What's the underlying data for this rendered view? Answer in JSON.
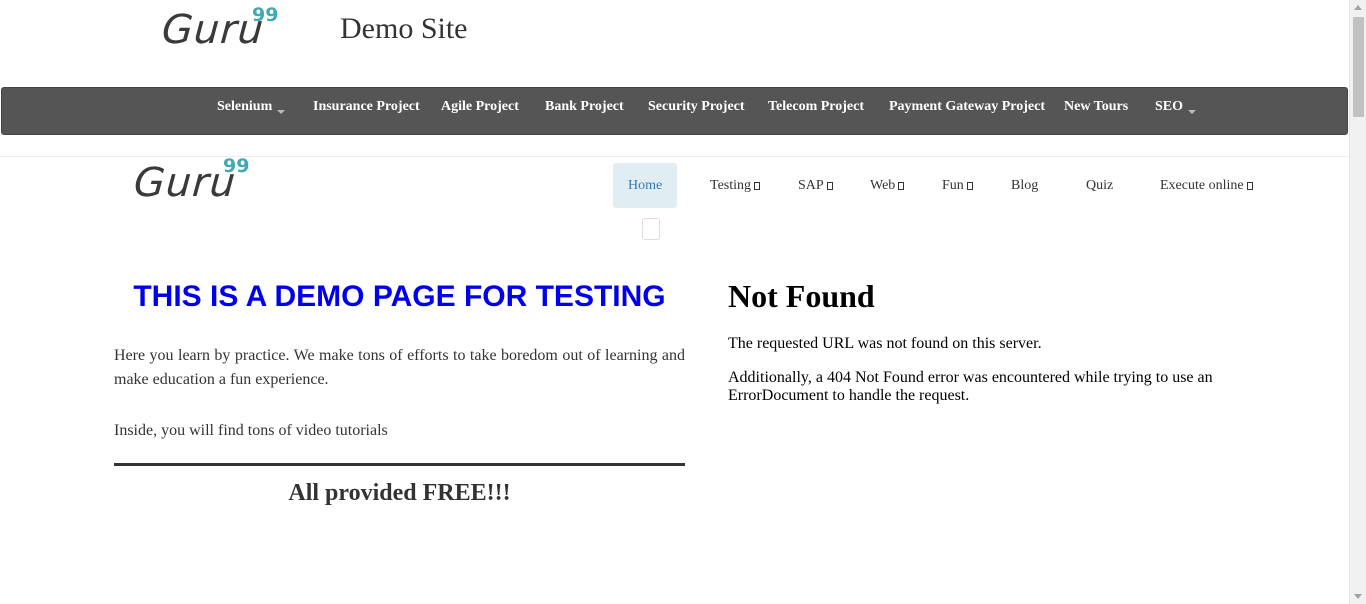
{
  "top_header": {
    "logo_word": "Guru",
    "logo_number": "99",
    "site_title": "Demo Site"
  },
  "navbar": {
    "items": [
      {
        "label": "Selenium",
        "has_dropdown": true
      },
      {
        "label": "Insurance Project"
      },
      {
        "label": "Agile Project"
      },
      {
        "label": "Bank Project"
      },
      {
        "label": "Security Project"
      },
      {
        "label": "Telecom Project"
      },
      {
        "label": "Payment Gateway Project"
      },
      {
        "label": "New Tours"
      },
      {
        "label": "SEO",
        "has_dropdown": true
      }
    ]
  },
  "second_header": {
    "logo_word": "Guru",
    "logo_number": "99",
    "menu": [
      {
        "label": "Home",
        "active": true
      },
      {
        "label": "Testing",
        "glyph": true
      },
      {
        "label": "SAP",
        "glyph": true
      },
      {
        "label": "Web",
        "glyph": true
      },
      {
        "label": "Fun",
        "glyph": true
      },
      {
        "label": "Blog"
      },
      {
        "label": "Quiz"
      },
      {
        "label": "Execute online",
        "glyph": true
      }
    ]
  },
  "main": {
    "heading": "THIS IS A DEMO PAGE FOR TESTING",
    "intro": "Here you learn by practice. We make tons of efforts to take boredom out of learning and make education a fun experience.",
    "inside": "Inside, you will find tons of video tutorials",
    "free": "All provided FREE!!!"
  },
  "not_found": {
    "title": "Not Found",
    "text1": "The requested URL was not found on this server.",
    "text2": "Additionally, a 404 Not Found error was encountered while trying to use an ErrorDocument to handle the request."
  },
  "colors": {
    "navbar_bg": "#555555",
    "heading_blue": "#0000ee",
    "logo_accent": "#3fa9b5",
    "active_menu_bg": "#e0eef3"
  }
}
